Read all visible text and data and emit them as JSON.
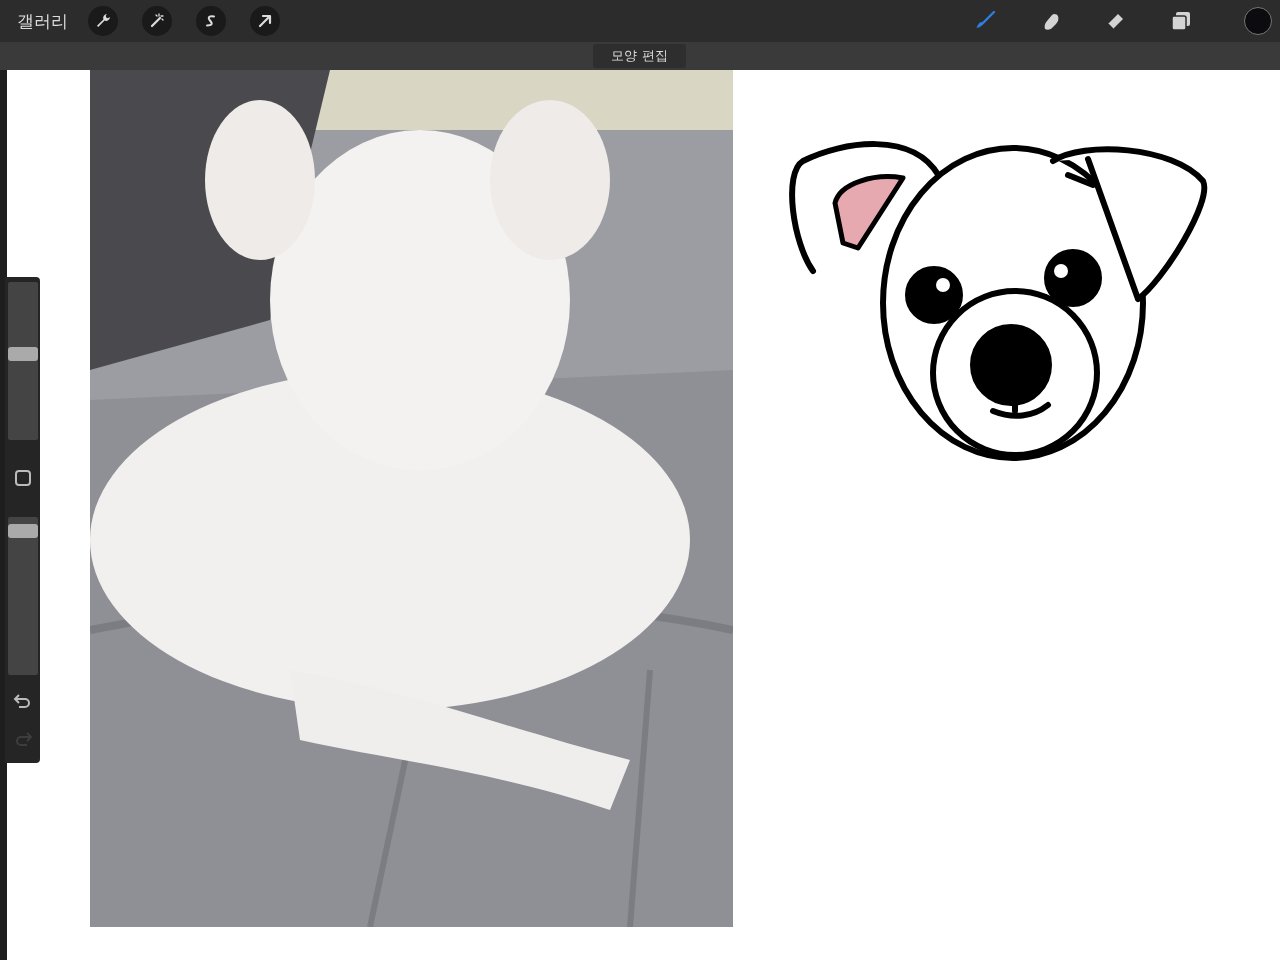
{
  "toolbar": {
    "gallery": "갤러리",
    "actions": [
      {
        "kind": "wrench"
      },
      {
        "kind": "wand"
      },
      {
        "kind": "selection"
      },
      {
        "kind": "transform"
      }
    ],
    "tools": [
      {
        "kind": "brush",
        "selected": true
      },
      {
        "kind": "smudge",
        "selected": false
      },
      {
        "kind": "eraser",
        "selected": false
      },
      {
        "kind": "layers",
        "selected": false
      }
    ],
    "color_swatch": {
      "color": "#0b0b10"
    }
  },
  "mode_label": "모양 편집",
  "sidebar": {
    "size_slider": {
      "level": 0.55
    },
    "opacity_slider": {
      "level": 0.95
    },
    "undo": {
      "disabled": false
    },
    "redo": {
      "disabled": true
    }
  }
}
